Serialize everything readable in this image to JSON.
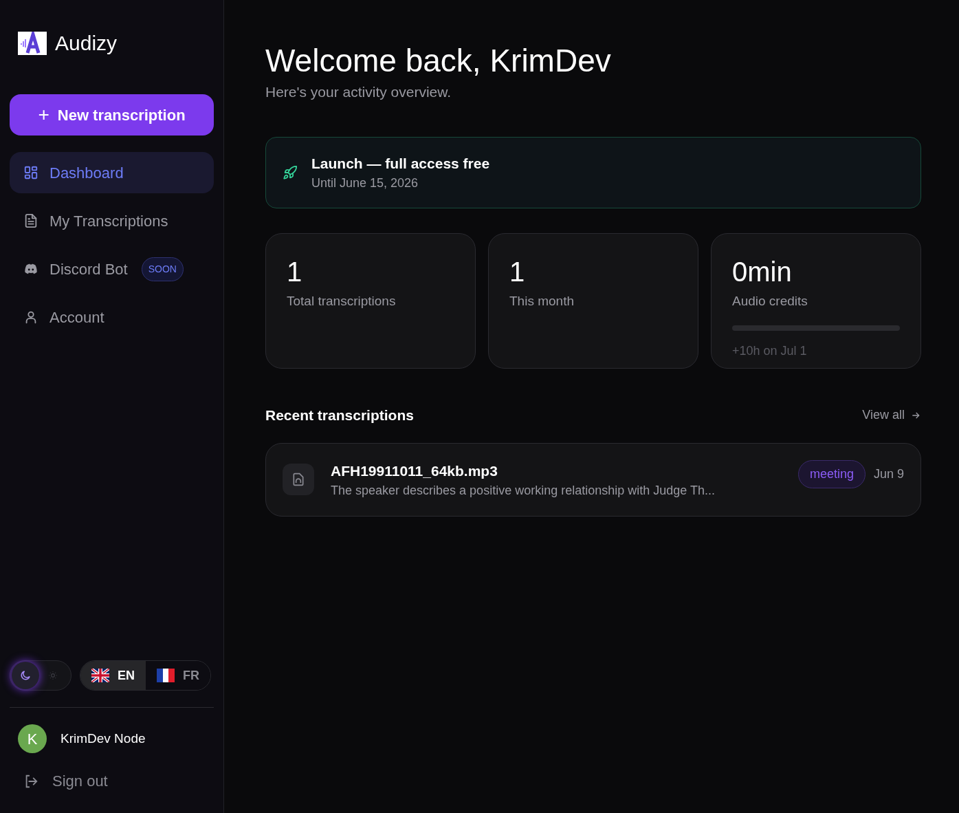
{
  "brand": {
    "name": "Audizy"
  },
  "new_button": {
    "icon": "+",
    "label": "New transcription"
  },
  "nav": [
    {
      "kind": "grid",
      "label": "Dashboard",
      "selected": true
    },
    {
      "kind": "document",
      "label": "My Transcriptions",
      "selected": false
    },
    {
      "kind": "discord",
      "label": "Discord Bot",
      "selected": false,
      "badge": "SOON"
    },
    {
      "kind": "user",
      "label": "Account",
      "selected": false
    }
  ],
  "theme": [
    {
      "kind": "moon",
      "selected": true
    },
    {
      "kind": "sun",
      "selected": false
    }
  ],
  "languages": [
    {
      "kind": "uk",
      "code": "EN",
      "selected": true
    },
    {
      "kind": "fr",
      "code": "FR",
      "selected": false
    }
  ],
  "user": {
    "initial": "K",
    "name": "KrimDev Node",
    "color": "#6aa84f"
  },
  "sign_out": "Sign out",
  "heading": "Welcome back, KrimDev",
  "subheading": "Here's your activity overview.",
  "banner": {
    "title": "Launch — full access free",
    "subtitle": "Until June 15, 2026"
  },
  "stats": [
    {
      "kind": "count",
      "value": "1",
      "label": "Total transcriptions"
    },
    {
      "kind": "count",
      "value": "1",
      "label": "This month"
    },
    {
      "kind": "credits",
      "value": "0min",
      "label": "Audio credits",
      "level": 0,
      "note": "+10h on Jul 1"
    }
  ],
  "recent": {
    "title": "Recent transcriptions",
    "view_all": "View all",
    "items": [
      {
        "name": "AFH19911011_64kb.mp3",
        "summary": "The speaker describes a positive working relationship with Judge Th...",
        "tag": "meeting",
        "date": "Jun 9"
      }
    ]
  }
}
